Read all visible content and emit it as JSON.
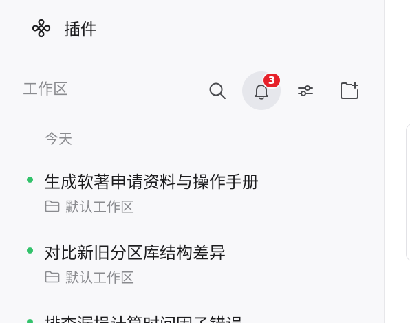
{
  "plugin": {
    "label": "插件",
    "icon": "plugin-icon"
  },
  "workspace": {
    "header": "工作区",
    "notifications": {
      "count": "3",
      "icon": "bell-icon"
    },
    "actions": [
      "search-icon",
      "bell-icon",
      "filter-sliders-icon",
      "new-folder-icon"
    ]
  },
  "section": {
    "today_label": "今天"
  },
  "tasks": [
    {
      "title": "生成软著申请资料与操作手册",
      "workspace": "默认工作区",
      "status": "active"
    },
    {
      "title": "对比新旧分区库结构差异",
      "workspace": "默认工作区",
      "status": "active"
    },
    {
      "title": "排查漏损计算时间因子错误",
      "workspace": "",
      "status": "active"
    }
  ],
  "colors": {
    "sidebar_bg": "#f8f8fa",
    "status_dot": "#33c26b",
    "badge": "#e6212a",
    "active_btn_bg": "#e6e7ec"
  }
}
